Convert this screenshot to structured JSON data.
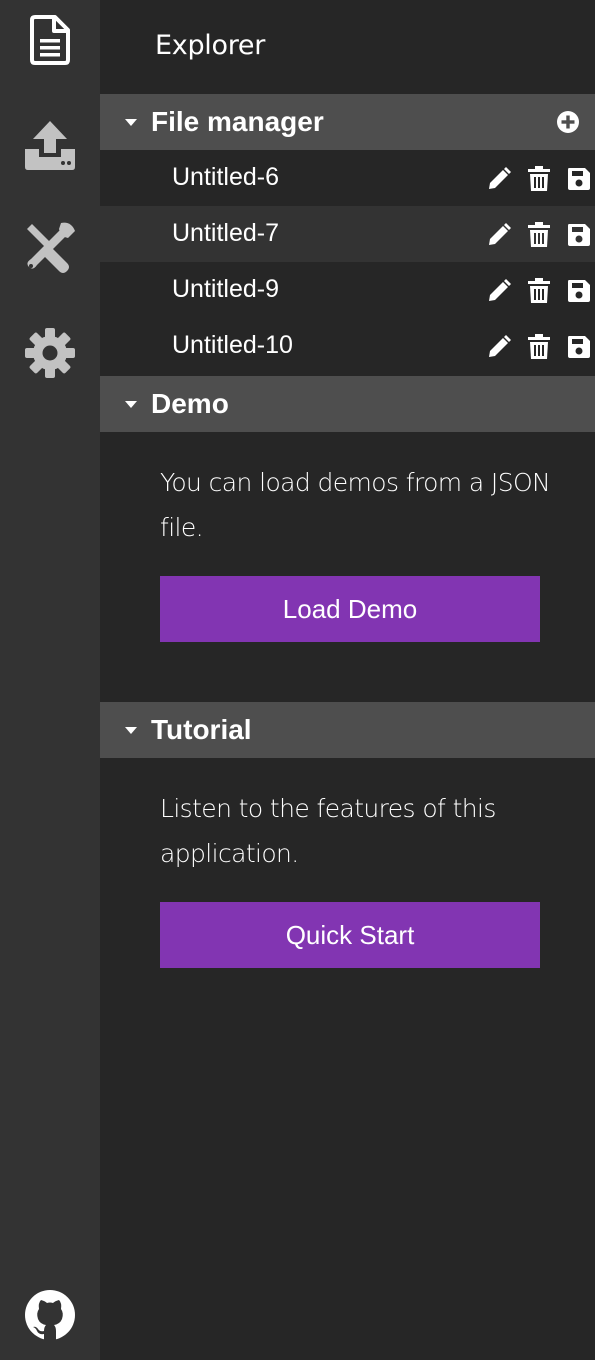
{
  "activity_bar": {
    "items": [
      {
        "icon": "file-document-icon",
        "active": true
      },
      {
        "icon": "upload-icon",
        "active": false
      },
      {
        "icon": "tools-icon",
        "active": false
      },
      {
        "icon": "gear-icon",
        "active": false
      }
    ],
    "footer_icon": "github-icon"
  },
  "sidebar": {
    "title": "Explorer",
    "file_manager": {
      "title": "File manager",
      "add_icon": "add-circle-icon",
      "files": [
        {
          "name": "Untitled-6"
        },
        {
          "name": "Untitled-7"
        },
        {
          "name": "Untitled-9"
        },
        {
          "name": "Untitled-10"
        }
      ]
    },
    "demo": {
      "title": "Demo",
      "description": "You can load demos from a JSON file.",
      "button_label": "Load Demo"
    },
    "tutorial": {
      "title": "Tutorial",
      "description": "Listen to the features of this application.",
      "button_label": "Quick Start"
    }
  },
  "colors": {
    "activity_bar_bg": "#333333",
    "sidebar_bg": "#262626",
    "section_header_bg": "#4e4e4e",
    "accent_purple": "#8235b2",
    "icon_inactive": "#c2c2c2",
    "icon_active": "#ffffff"
  }
}
